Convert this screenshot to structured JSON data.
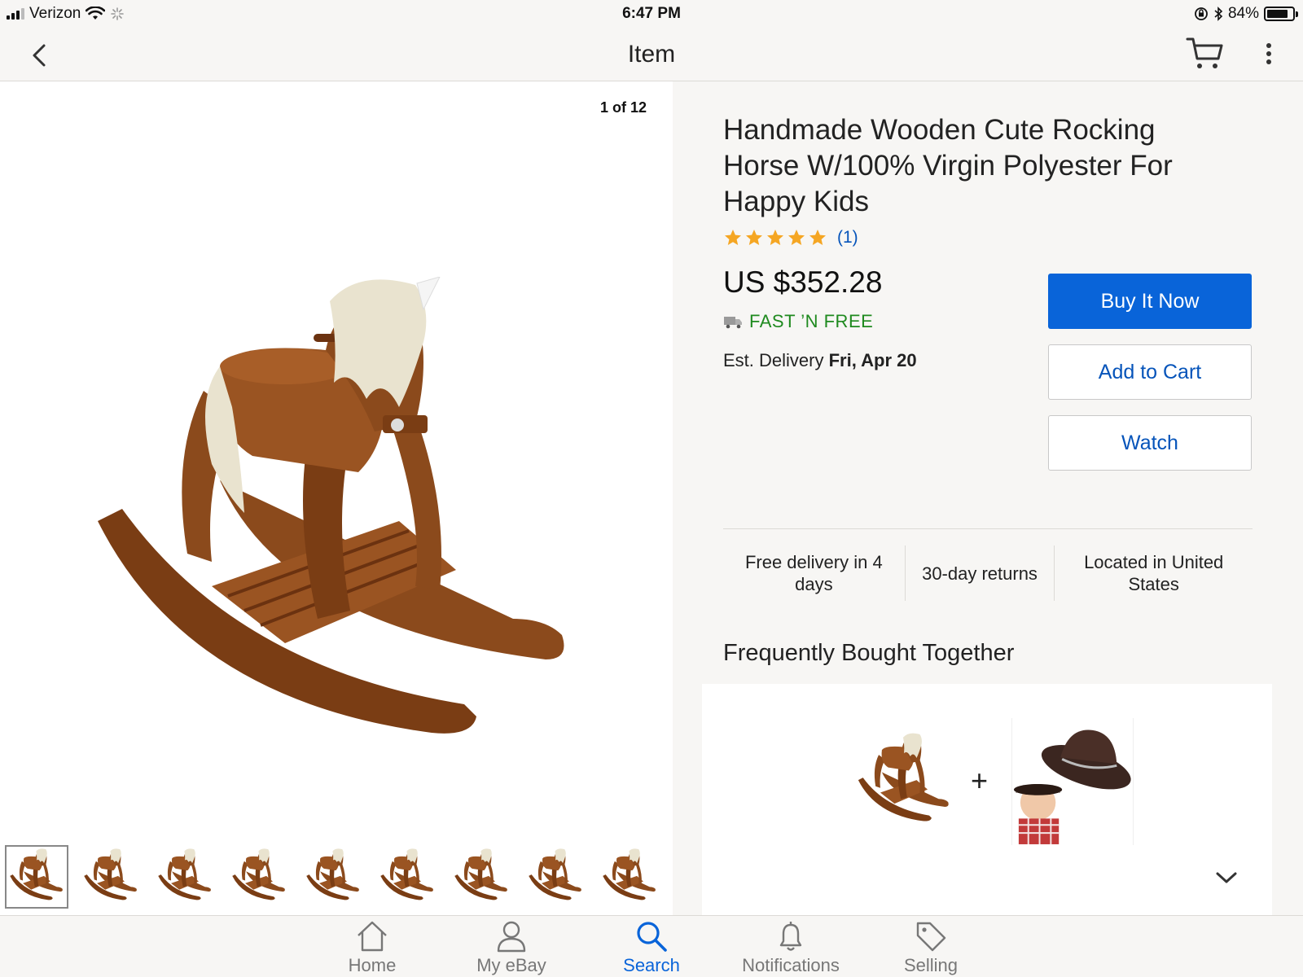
{
  "status_bar": {
    "carrier": "Verizon",
    "time": "6:47 PM",
    "battery": "84%",
    "battery_level": 0.84
  },
  "nav": {
    "title": "Item",
    "back_icon": "chevron-left-icon",
    "cart_icon": "cart-icon",
    "more_icon": "more-vertical-icon"
  },
  "gallery": {
    "counter": "1 of 12",
    "thumbnail_count": 9,
    "active_thumbnail": 1
  },
  "item": {
    "title": "Handmade Wooden Cute Rocking Horse W/100% Virgin Polyester For Happy Kids",
    "stars": 5,
    "rating_count": "(1)",
    "price": "US $352.28",
    "shipping": "FAST ’N FREE",
    "delivery_label": "Est. Delivery",
    "delivery_date": "Fri, Apr 20"
  },
  "actions": {
    "buy_now": "Buy It Now",
    "add_to_cart": "Add to Cart",
    "watch": "Watch"
  },
  "features": [
    "Free delivery in 4 days",
    "30-day returns",
    "Located in United States"
  ],
  "fbt": {
    "heading": "Frequently Bought Together",
    "plus": "+"
  },
  "tabs": [
    {
      "label": "Home",
      "icon": "home-icon",
      "active": false
    },
    {
      "label": "My eBay",
      "icon": "person-icon",
      "active": false
    },
    {
      "label": "Search",
      "icon": "search-icon",
      "active": true
    },
    {
      "label": "Notifications",
      "icon": "bell-icon",
      "active": false
    },
    {
      "label": "Selling",
      "icon": "tag-icon",
      "active": false
    }
  ],
  "colors": {
    "primary_blue": "#0964d9",
    "link_blue": "#0654ba",
    "free_shipping_green": "#1f8a1f",
    "star_orange": "#f5a623",
    "wood_brown": "#8b4a1c"
  }
}
